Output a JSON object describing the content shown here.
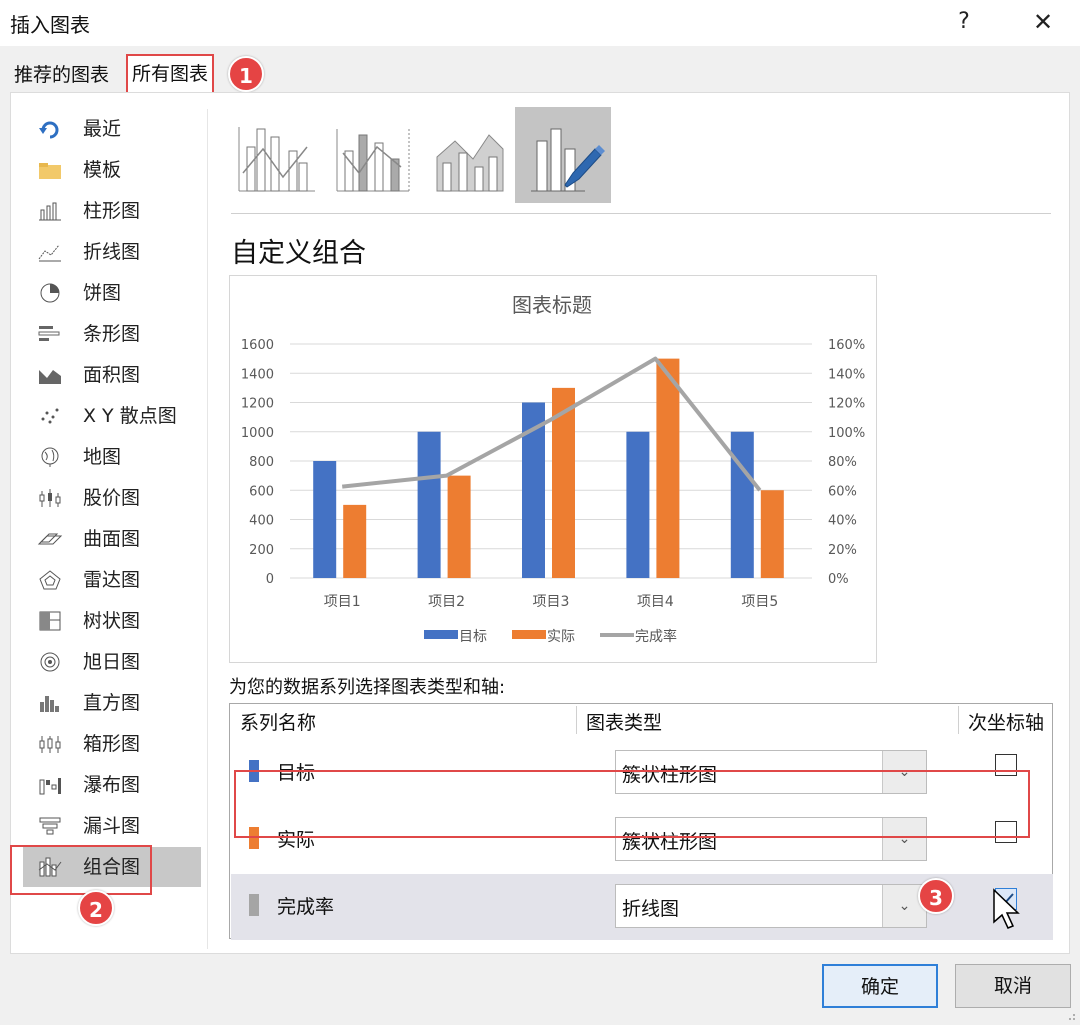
{
  "dialog": {
    "title": "插入图表",
    "help": "?",
    "close": "✕"
  },
  "tabs": [
    {
      "label": "推荐的图表"
    },
    {
      "label": "所有图表"
    }
  ],
  "annotations": [
    "1",
    "2",
    "3"
  ],
  "sidebar": {
    "items": [
      {
        "label": "最近",
        "icon": "recent-icon"
      },
      {
        "label": "模板",
        "icon": "folder-icon"
      },
      {
        "label": "柱形图",
        "icon": "column-chart-icon"
      },
      {
        "label": "折线图",
        "icon": "line-chart-icon"
      },
      {
        "label": "饼图",
        "icon": "pie-chart-icon"
      },
      {
        "label": "条形图",
        "icon": "bar-chart-icon"
      },
      {
        "label": "面积图",
        "icon": "area-chart-icon"
      },
      {
        "label": "X Y 散点图",
        "icon": "scatter-chart-icon"
      },
      {
        "label": "地图",
        "icon": "map-chart-icon"
      },
      {
        "label": "股价图",
        "icon": "stock-chart-icon"
      },
      {
        "label": "曲面图",
        "icon": "surface-chart-icon"
      },
      {
        "label": "雷达图",
        "icon": "radar-chart-icon"
      },
      {
        "label": "树状图",
        "icon": "treemap-icon"
      },
      {
        "label": "旭日图",
        "icon": "sunburst-icon"
      },
      {
        "label": "直方图",
        "icon": "histogram-icon"
      },
      {
        "label": "箱形图",
        "icon": "box-whisker-icon"
      },
      {
        "label": "瀑布图",
        "icon": "waterfall-icon"
      },
      {
        "label": "漏斗图",
        "icon": "funnel-icon"
      },
      {
        "label": "组合图",
        "icon": "combo-chart-icon",
        "active": true
      }
    ]
  },
  "main": {
    "section_title": "自定义组合",
    "series_heading": "为您的数据系列选择图表类型和轴:",
    "columns": [
      "系列名称",
      "图表类型",
      "次坐标轴"
    ],
    "rows": [
      {
        "name": "目标",
        "color": "#4472c4",
        "type": "簇状柱形图",
        "secondary": false
      },
      {
        "name": "实际",
        "color": "#ed7d31",
        "type": "簇状柱形图",
        "secondary": false
      },
      {
        "name": "完成率",
        "color": "#a5a5a5",
        "type": "折线图",
        "secondary": true
      }
    ]
  },
  "buttons": {
    "ok": "确定",
    "cancel": "取消"
  },
  "chart_data": {
    "type": "bar",
    "title": "图表标题",
    "categories": [
      "项目1",
      "项目2",
      "项目3",
      "项目4",
      "项目5"
    ],
    "series": [
      {
        "name": "目标",
        "type": "bar",
        "color": "#4472c4",
        "values": [
          800,
          1000,
          1200,
          1000,
          1000
        ],
        "axis": "primary"
      },
      {
        "name": "实际",
        "type": "bar",
        "color": "#ed7d31",
        "values": [
          500,
          700,
          1300,
          1500,
          600
        ],
        "axis": "primary"
      },
      {
        "name": "完成率",
        "type": "line",
        "color": "#a5a5a5",
        "values": [
          0.625,
          0.7,
          1.083,
          1.5,
          0.6
        ],
        "axis": "secondary"
      }
    ],
    "ylim": [
      0,
      1600
    ],
    "yticks": [
      "0",
      "200",
      "400",
      "600",
      "800",
      "1000",
      "1200",
      "1400",
      "1600"
    ],
    "y2lim": [
      0,
      1.6
    ],
    "y2ticks": [
      "0%",
      "20%",
      "40%",
      "60%",
      "80%",
      "100%",
      "120%",
      "140%",
      "160%"
    ],
    "legend": "bottom",
    "grid": true
  }
}
